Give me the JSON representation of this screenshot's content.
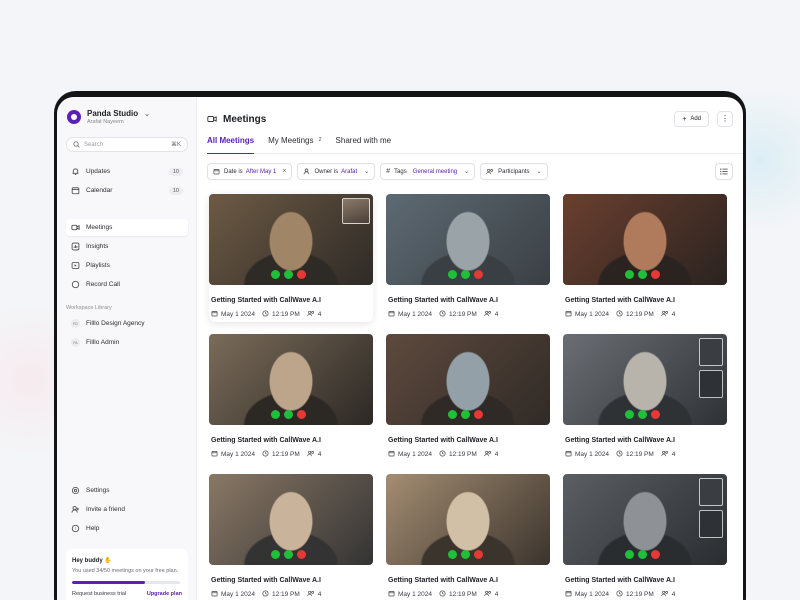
{
  "workspace": {
    "name": "Panda Studio",
    "user": "Arafat Nayeem"
  },
  "search": {
    "placeholder": "Search",
    "shortcut": "⌘K"
  },
  "sidebar": {
    "primary": [
      {
        "label": "Updates",
        "icon": "bell-icon",
        "count": "10"
      },
      {
        "label": "Calendar",
        "icon": "calendar-icon",
        "count": "10"
      }
    ],
    "nav": [
      {
        "label": "Meetings",
        "icon": "video-icon",
        "active": true
      },
      {
        "label": "Insights",
        "icon": "chart-icon"
      },
      {
        "label": "Playlists",
        "icon": "playlist-icon"
      },
      {
        "label": "Record Call",
        "icon": "record-icon"
      }
    ],
    "library_label": "Workspace Library",
    "library": [
      {
        "label": "Filllo Design Agency",
        "badge": "FD"
      },
      {
        "label": "Filllo Admin",
        "badge": "FA"
      }
    ],
    "footer": [
      {
        "label": "Settings",
        "icon": "gear-icon"
      },
      {
        "label": "Invite a friend",
        "icon": "invite-icon"
      },
      {
        "label": "Help",
        "icon": "help-icon"
      }
    ],
    "promo": {
      "title": "Hey buddy ✋",
      "subtitle": "You used 34/50 meetings on your free plan.",
      "progress": 0.68,
      "trial_label": "Request business trial",
      "upgrade_label": "Upgrade plan"
    }
  },
  "header": {
    "title": "Meetings",
    "add_label": "Add"
  },
  "tabs": [
    {
      "label": "All Meetings",
      "active": true,
      "count": ""
    },
    {
      "label": "My Meetings",
      "count": "2"
    },
    {
      "label": "Shared with me",
      "count": ""
    }
  ],
  "filters": {
    "date": {
      "label": "Date is",
      "value": "After May 1"
    },
    "owner": {
      "label": "Owner is",
      "value": "Arafat"
    },
    "tags": {
      "label": "Tags",
      "value": "General meeting"
    },
    "participants": {
      "label": "Participants"
    }
  },
  "colors": {
    "accent": "#5b21b6",
    "green": "#1fbf3a",
    "red": "#e53935"
  },
  "meetings": [
    {
      "title": "Getting Started with CallWave A.I",
      "date": "May 1 2024",
      "time": "12:19 PM",
      "participants": "4"
    },
    {
      "title": "Getting Started with CallWave A.I",
      "date": "May 1 2024",
      "time": "12:19 PM",
      "participants": "4"
    },
    {
      "title": "Getting Started with CallWave A.I",
      "date": "May 1 2024",
      "time": "12:19 PM",
      "participants": "4"
    },
    {
      "title": "Getting Started with CallWave A.I",
      "date": "May 1 2024",
      "time": "12:19 PM",
      "participants": "4"
    },
    {
      "title": "Getting Started with CallWave A.I",
      "date": "May 1 2024",
      "time": "12:19 PM",
      "participants": "4"
    },
    {
      "title": "Getting Started with CallWave A.I",
      "date": "May 1 2024",
      "time": "12:19 PM",
      "participants": "4"
    },
    {
      "title": "Getting Started with CallWave A.I",
      "date": "May 1 2024",
      "time": "12:19 PM",
      "participants": "4"
    },
    {
      "title": "Getting Started with CallWave A.I",
      "date": "May 1 2024",
      "time": "12:19 PM",
      "participants": "4"
    },
    {
      "title": "Getting Started with CallWave A.I",
      "date": "May 1 2024",
      "time": "12:19 PM",
      "participants": "4"
    }
  ]
}
